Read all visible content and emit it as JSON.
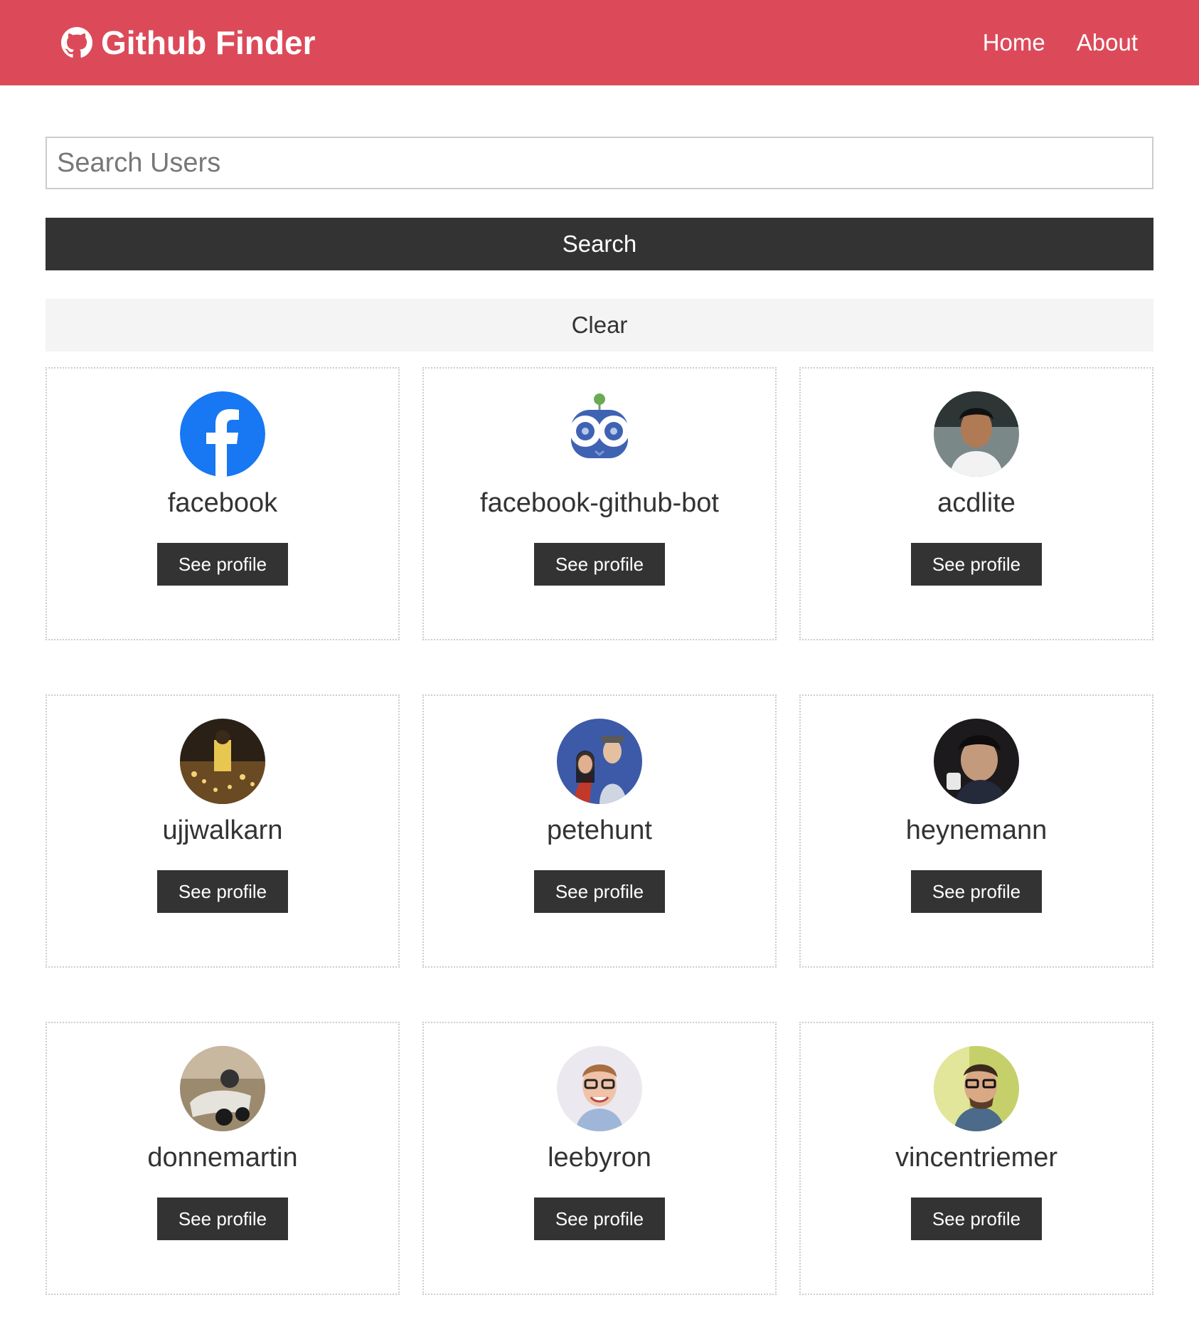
{
  "navbar": {
    "brand_icon": "github-icon",
    "title": "Github Finder",
    "links": [
      "Home",
      "About"
    ],
    "background": "#dc4a5a"
  },
  "search": {
    "placeholder": "Search Users",
    "value": "",
    "search_label": "Search",
    "clear_label": "Clear"
  },
  "users": [
    {
      "login": "facebook",
      "button": "See profile",
      "avatar": "facebook-logo"
    },
    {
      "login": "facebook-github-bot",
      "button": "See profile",
      "avatar": "bot-avatar"
    },
    {
      "login": "acdlite",
      "button": "See profile",
      "avatar": "photo"
    },
    {
      "login": "ujjwalkarn",
      "button": "See profile",
      "avatar": "photo"
    },
    {
      "login": "petehunt",
      "button": "See profile",
      "avatar": "photo"
    },
    {
      "login": "heynemann",
      "button": "See profile",
      "avatar": "photo"
    },
    {
      "login": "donnemartin",
      "button": "See profile",
      "avatar": "photo"
    },
    {
      "login": "leebyron",
      "button": "See profile",
      "avatar": "photo"
    },
    {
      "login": "vincentriemer",
      "button": "See profile",
      "avatar": "photo"
    }
  ]
}
